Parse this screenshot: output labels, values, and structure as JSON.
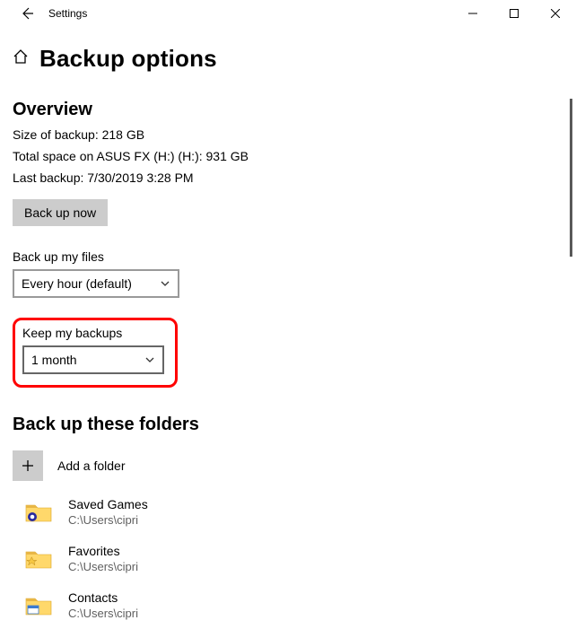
{
  "titlebar": {
    "title": "Settings"
  },
  "header": {
    "page_title": "Backup options"
  },
  "overview": {
    "heading": "Overview",
    "size_line": "Size of backup: 218 GB",
    "total_line": "Total space on ASUS FX (H:) (H:): 931 GB",
    "last_line": "Last backup: 7/30/2019 3:28 PM",
    "backup_btn": "Back up now"
  },
  "backup_freq": {
    "label": "Back up my files",
    "value": "Every hour (default)"
  },
  "keep": {
    "label": "Keep my backups",
    "value": "1 month"
  },
  "folders": {
    "heading": "Back up these folders",
    "add_label": "Add a folder",
    "items": [
      {
        "name": "Saved Games",
        "path": "C:\\Users\\cipri"
      },
      {
        "name": "Favorites",
        "path": "C:\\Users\\cipri"
      },
      {
        "name": "Contacts",
        "path": "C:\\Users\\cipri"
      }
    ]
  }
}
